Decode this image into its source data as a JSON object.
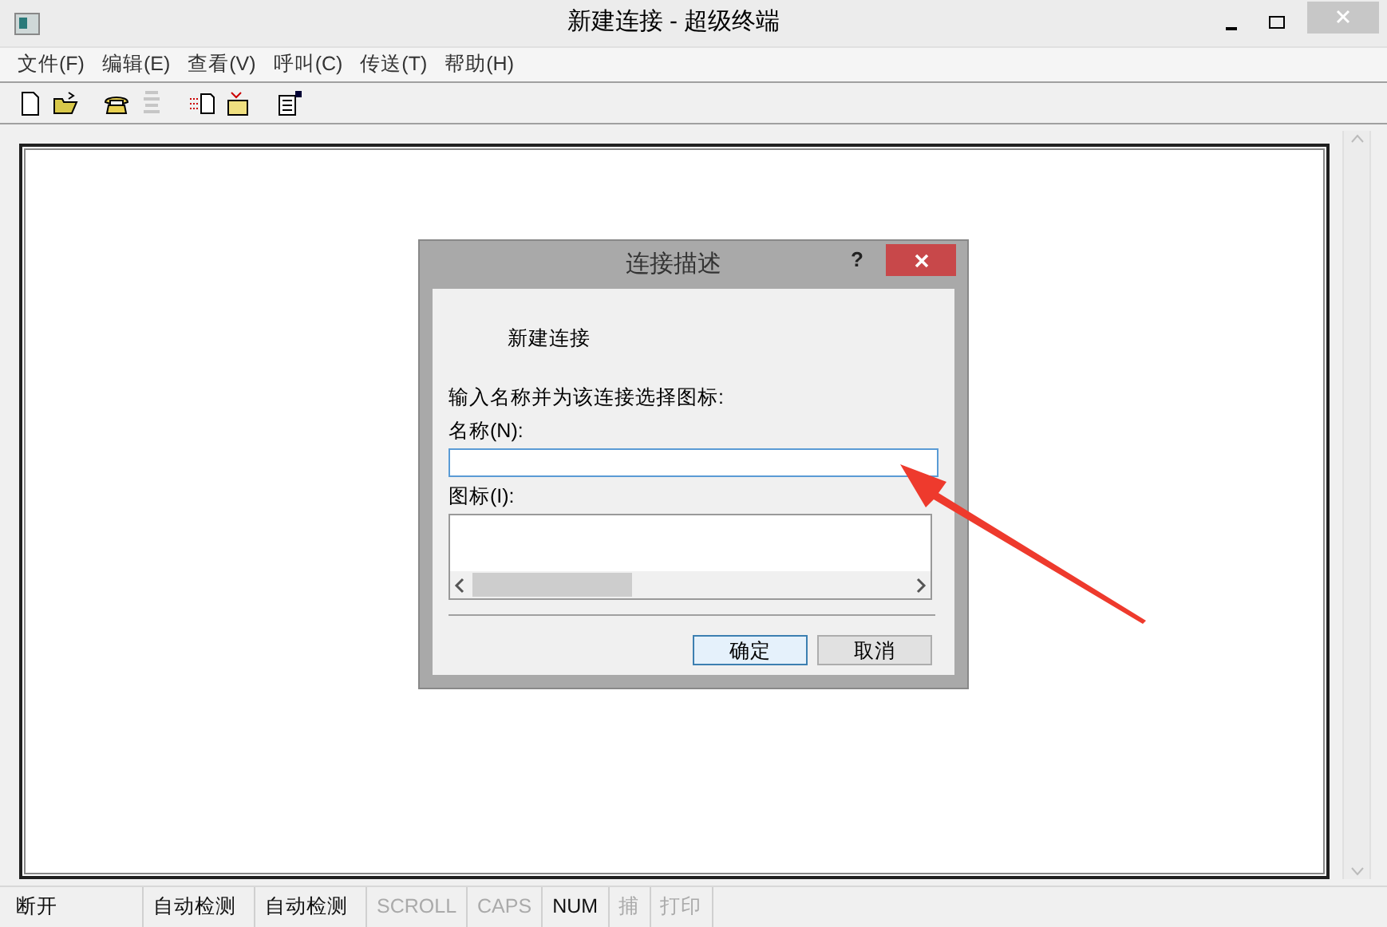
{
  "window": {
    "title": "新建连接 - 超级终端"
  },
  "menu": [
    "文件(F)",
    "编辑(E)",
    "查看(V)",
    "呼叫(C)",
    "传送(T)",
    "帮助(H)"
  ],
  "toolbar": [
    {
      "kind": "new",
      "disabled": false
    },
    {
      "kind": "open",
      "disabled": false
    },
    {
      "kind": "call",
      "disabled": false
    },
    {
      "kind": "hangup",
      "disabled": true
    },
    {
      "kind": "send",
      "disabled": false
    },
    {
      "kind": "receive",
      "disabled": false
    },
    {
      "kind": "properties",
      "disabled": false
    }
  ],
  "dialog": {
    "title": "连接描述",
    "help": "?",
    "heading": "新建连接",
    "prompt": "输入名称并为该连接选择图标:",
    "name_label": "名称(N):",
    "icon_label": "图标(I):",
    "buttons": [
      {
        "label": "确定",
        "default": true
      },
      {
        "label": "取消",
        "default": false
      }
    ]
  },
  "status_bar": [
    {
      "text": "断开",
      "enabled": true
    },
    {
      "text": "自动检测",
      "enabled": true
    },
    {
      "text": "自动检测",
      "enabled": true
    },
    {
      "text": "SCROLL",
      "enabled": false
    },
    {
      "text": "CAPS",
      "enabled": false
    },
    {
      "text": "NUM",
      "enabled": true
    },
    {
      "text": "捕",
      "enabled": false
    },
    {
      "text": "打印",
      "enabled": false
    }
  ]
}
